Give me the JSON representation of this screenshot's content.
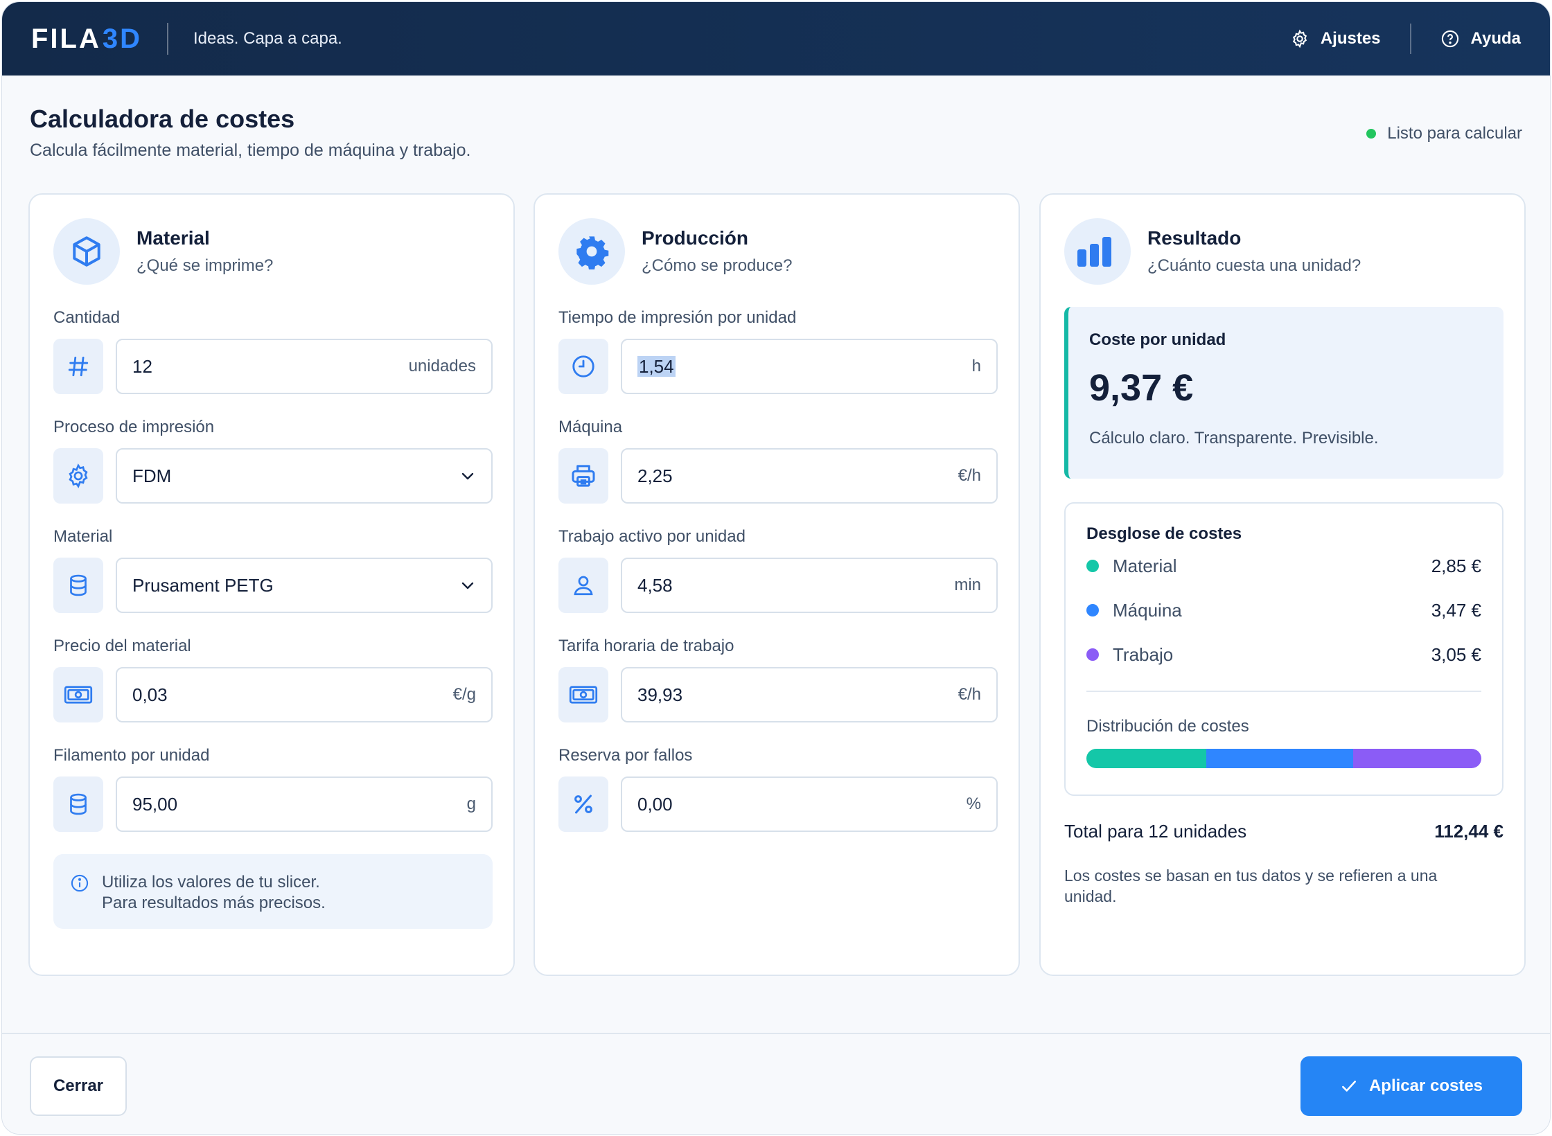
{
  "header": {
    "logo_main": "FILA",
    "logo_accent": "3D",
    "tagline": "Ideas. Capa a capa.",
    "settings_label": "Ajustes",
    "help_label": "Ayuda"
  },
  "page": {
    "title": "Calculadora de costes",
    "subtitle": "Calcula fácilmente material, tiempo de máquina y trabajo.",
    "status": "Listo para calcular"
  },
  "material": {
    "title": "Material",
    "subtitle": "¿Qué se imprime?",
    "quantity_label": "Cantidad",
    "quantity_value": "12",
    "quantity_unit": "unidades",
    "process_label": "Proceso de impresión",
    "process_value": "FDM",
    "material_label": "Material",
    "material_value": "Prusament PETG",
    "price_label": "Precio del material",
    "price_value": "0,03",
    "price_unit": "€/g",
    "filament_label": "Filamento por unidad",
    "filament_value": "95,00",
    "filament_unit": "g",
    "info_line1": "Utiliza los valores de tu slicer.",
    "info_line2": "Para resultados más precisos."
  },
  "production": {
    "title": "Producción",
    "subtitle": "¿Cómo se produce?",
    "print_time_label": "Tiempo de impresión por unidad",
    "print_time_value": "1,54",
    "print_time_unit": "h",
    "machine_label": "Máquina",
    "machine_value": "2,25",
    "machine_unit": "€/h",
    "active_work_label": "Trabajo activo por unidad",
    "active_work_value": "4,58",
    "active_work_unit": "min",
    "labor_rate_label": "Tarifa horaria de trabajo",
    "labor_rate_value": "39,93",
    "labor_rate_unit": "€/h",
    "failure_label": "Reserva por fallos",
    "failure_value": "0,00",
    "failure_unit": "%"
  },
  "result": {
    "title": "Resultado",
    "subtitle": "¿Cuánto cuesta una unidad?",
    "unit_cost_label": "Coste por unidad",
    "unit_cost_value": "9,37 €",
    "unit_cost_note": "Cálculo claro. Transparente. Previsible.",
    "breakdown_title": "Desglose de costes",
    "breakdown": [
      {
        "name": "Material",
        "amount": "2,85 €",
        "color": "#14c7a8",
        "share": 0.304
      },
      {
        "name": "Máquina",
        "amount": "3,47 €",
        "color": "#2f86ff",
        "share": 0.371
      },
      {
        "name": "Trabajo",
        "amount": "3,05 €",
        "color": "#8b5cf6",
        "share": 0.325
      }
    ],
    "distribution_label": "Distribución de costes",
    "total_label": "Total para 12 unidades",
    "total_value": "112,44 €",
    "footnote": "Los costes se basan en tus datos y se refieren a una unidad."
  },
  "footer": {
    "close_label": "Cerrar",
    "apply_label": "Aplicar costes"
  },
  "colors": {
    "accent": "#2585f5",
    "header_bg": "#132a4a",
    "status_ok": "#22c55e",
    "result_border": "#14b8a6"
  },
  "icons": {
    "settings": "gear-icon",
    "help": "question-circle-icon",
    "material": "cube-icon",
    "production": "cog-icon",
    "result": "bar-chart-icon"
  }
}
